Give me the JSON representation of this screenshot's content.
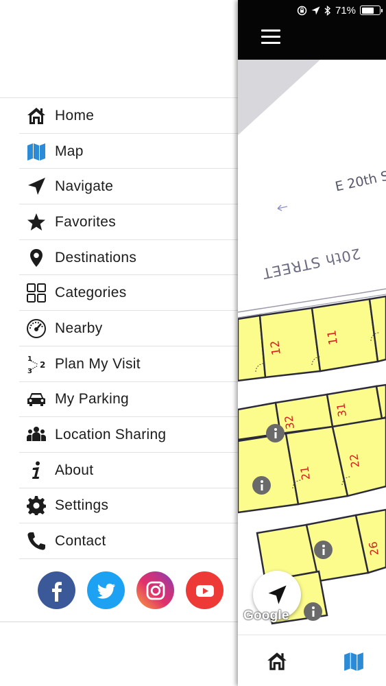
{
  "menu": {
    "items": [
      {
        "label": "Home",
        "icon": "home-icon"
      },
      {
        "label": "Map",
        "icon": "map-icon"
      },
      {
        "label": "Navigate",
        "icon": "navigate-arrow-icon"
      },
      {
        "label": "Favorites",
        "icon": "star-icon"
      },
      {
        "label": "Destinations",
        "icon": "location-pin-icon"
      },
      {
        "label": "Categories",
        "icon": "grid-icon"
      },
      {
        "label": "Nearby",
        "icon": "speedometer-icon"
      },
      {
        "label": "Plan My Visit",
        "icon": "numbered-steps-icon"
      },
      {
        "label": "My Parking",
        "icon": "car-icon"
      },
      {
        "label": "Location Sharing",
        "icon": "people-icon"
      },
      {
        "label": "About",
        "icon": "info-icon"
      },
      {
        "label": "Settings",
        "icon": "gear-icon"
      },
      {
        "label": "Contact",
        "icon": "phone-icon"
      }
    ],
    "active_color": "#2b8bd6",
    "text_color": "#1c1c1c"
  },
  "social": [
    {
      "name": "facebook",
      "icon": "facebook-icon",
      "color": "#3b5998"
    },
    {
      "name": "twitter",
      "icon": "twitter-icon",
      "color": "#1da1f2"
    },
    {
      "name": "instagram",
      "icon": "instagram-icon",
      "color": "#c13584"
    },
    {
      "name": "youtube",
      "icon": "youtube-icon",
      "color": "#ee3a36"
    }
  ],
  "status_bar": {
    "battery_text": "71%",
    "battery_level": 0.71
  },
  "map": {
    "street_labels": [
      "E 20th S",
      "20th STREET"
    ],
    "booth_numbers": [
      "12",
      "11",
      "32",
      "31",
      "21",
      "22",
      "26"
    ],
    "attribution": "Google",
    "booth_fill": "#fcfc8c"
  },
  "bottom_tabs": [
    {
      "icon": "home-icon",
      "active": false
    },
    {
      "icon": "map-icon",
      "active": true
    }
  ]
}
